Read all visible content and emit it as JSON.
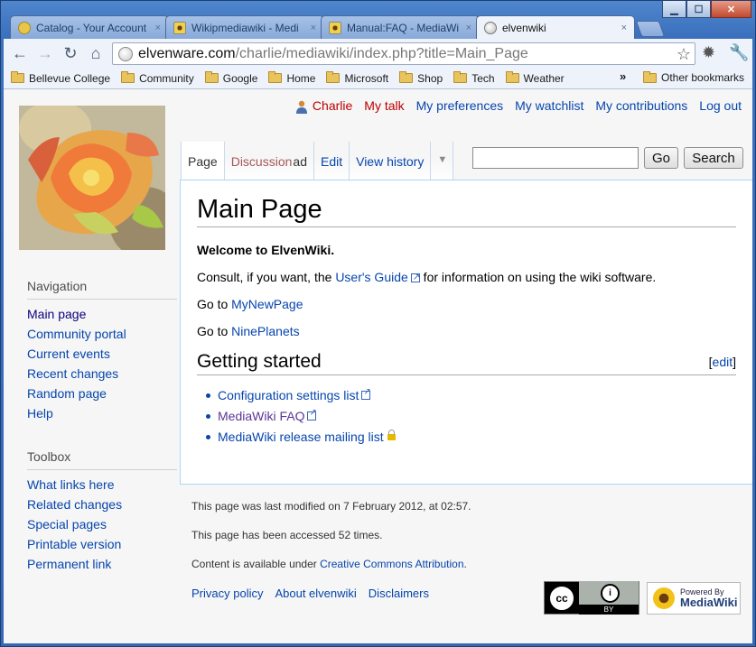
{
  "browser": {
    "tabs": [
      {
        "label": "Catalog - Your Account",
        "fav_color": "#e8c64a",
        "active": false
      },
      {
        "label": "Wikipmediawiki - Medi",
        "fav_color": "#f0d24a",
        "active": false
      },
      {
        "label": "Manual:FAQ - MediaWi",
        "fav_color": "#f0d24a",
        "active": false
      },
      {
        "label": "elvenwiki",
        "fav_color": "#c8c8c8",
        "active": true
      }
    ],
    "close_glyph": "×",
    "window_buttons": {
      "minimize": "▁",
      "maximize": "☐",
      "close": "✕"
    },
    "url_host": "elvenware.com",
    "url_path": "/charlie/mediawiki/index.php?title=Main_Page",
    "icons": {
      "back": "←",
      "forward": "→",
      "reload": "↻",
      "home": "⌂",
      "star": "☆",
      "gear": "✹",
      "wrench": "🔧",
      "chevron": "»"
    },
    "bookmarks": [
      "Bellevue College",
      "Community",
      "Google",
      "Home",
      "Microsoft",
      "Shop",
      "Tech",
      "Weather"
    ],
    "other_bookmarks": "Other bookmarks"
  },
  "wiki": {
    "personal": {
      "user": "Charlie",
      "talk": "My talk",
      "preferences": "My preferences",
      "watchlist": "My watchlist",
      "contributions": "My contributions",
      "logout": "Log out"
    },
    "tabs": {
      "page": "Page",
      "discussion": "Discussion",
      "read_tail": "ad",
      "edit": "Edit",
      "history": "View history",
      "more": "▼"
    },
    "search": {
      "go": "Go",
      "search": "Search",
      "value": ""
    },
    "content": {
      "title": "Main Page",
      "welcome": "Welcome to ElvenWiki.",
      "consult_pre": "Consult, if you want, the ",
      "users_guide": "User's Guide",
      "consult_post": " for information on using the wiki software.",
      "goto1_pre": "Go to ",
      "goto1_link": "MyNewPage",
      "goto2_pre": "Go to ",
      "goto2_link": "NinePlanets",
      "section": "Getting started",
      "edit_open": "[",
      "edit_label": "edit",
      "edit_close": "]",
      "links": [
        "Configuration settings list",
        "MediaWiki FAQ",
        "MediaWiki release mailing list"
      ]
    },
    "navigation": {
      "heading": "Navigation",
      "items": [
        "Main page",
        "Community portal",
        "Current events",
        "Recent changes",
        "Random page",
        "Help"
      ]
    },
    "toolbox": {
      "heading": "Toolbox",
      "items": [
        "What links here",
        "Related changes",
        "Special pages",
        "Printable version",
        "Permanent link"
      ]
    },
    "footer": {
      "modified": "This page was last modified on 7 February 2012, at 02:57.",
      "accessed": "This page has been accessed 52 times.",
      "license_pre": "Content is available under ",
      "license_link": "Creative Commons Attribution",
      "license_post": ".",
      "links": [
        "Privacy policy",
        "About elvenwiki",
        "Disclaimers"
      ]
    },
    "badges": {
      "cc": "cc",
      "cc_by_icon": "i",
      "cc_by": "BY",
      "mw_powered": "Powered By",
      "mw_name": "MediaWiki"
    }
  }
}
